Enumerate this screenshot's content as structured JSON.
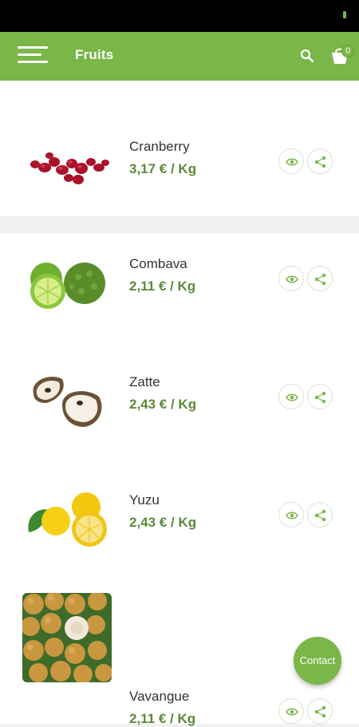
{
  "header": {
    "title": "Fruits",
    "cart_count": "0"
  },
  "colors": {
    "accent": "#7ab648",
    "price": "#5b8a3a",
    "background": "#f1f1f1"
  },
  "products": [
    {
      "name": "Cranberry",
      "price": "3,17 € / Kg"
    },
    {
      "name": "Combava",
      "price": "2,11 € / Kg"
    },
    {
      "name": "Zatte",
      "price": "2,43 € / Kg"
    },
    {
      "name": "Yuzu",
      "price": "2,43 € / Kg"
    },
    {
      "name": "Vavangue",
      "price": "2,11 € / Kg"
    }
  ],
  "fab": {
    "label": "Contact"
  },
  "icons": [
    "menu-icon",
    "search-icon",
    "cart-icon",
    "eye-icon",
    "share-icon"
  ]
}
